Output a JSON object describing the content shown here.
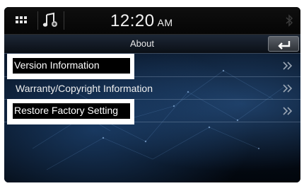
{
  "status_bar": {
    "menu_icon": "grid-menu-icon",
    "music_icon": "music-note-icon",
    "time": "12:20",
    "ampm": "AM",
    "bluetooth_icon": "bluetooth-icon"
  },
  "title_bar": {
    "title": "About",
    "back_icon": "back-arrow-icon"
  },
  "menu": {
    "items": [
      {
        "label": "Version Information",
        "chevron_icon": "double-chevron-right-icon"
      },
      {
        "label": "Warranty/Copyright Information",
        "chevron_icon": "double-chevron-right-icon"
      },
      {
        "label": "Restore Factory Setting",
        "chevron_icon": "double-chevron-right-icon"
      }
    ]
  },
  "colors": {
    "background": "#071222",
    "text": "#f0f0f0",
    "highlight_box": "#ffffff"
  }
}
